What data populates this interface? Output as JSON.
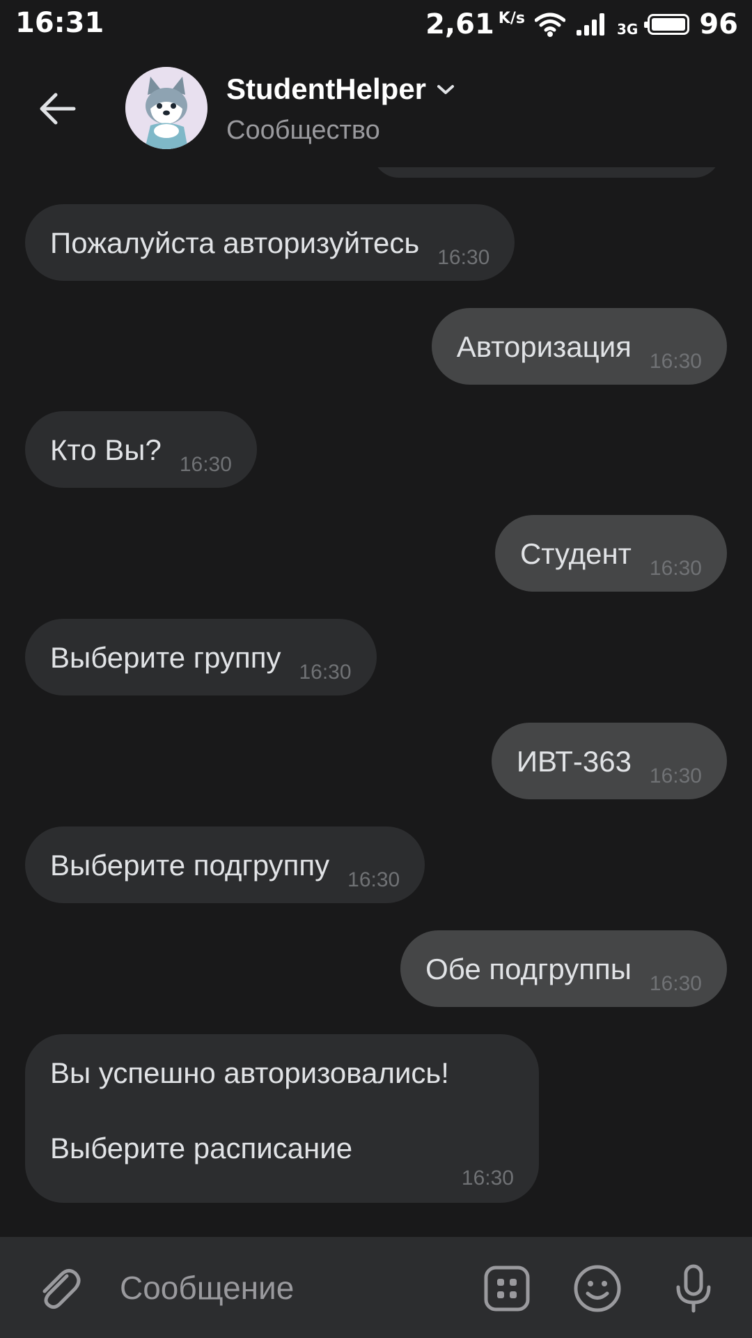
{
  "status_bar": {
    "time": "16:31",
    "speed": "2,61",
    "speed_unit": "K/s",
    "network": "3G",
    "battery": "96"
  },
  "header": {
    "title": "StudentHelper",
    "subtitle": "Сообщество"
  },
  "messages": [
    {
      "direction": "in",
      "text": "Пожалуйста авторизуйтесь",
      "time": "16:30"
    },
    {
      "direction": "out",
      "text": "Авторизация",
      "time": "16:30"
    },
    {
      "direction": "in",
      "text": "Кто Вы?",
      "time": "16:30"
    },
    {
      "direction": "out",
      "text": "Студент",
      "time": "16:30"
    },
    {
      "direction": "in",
      "text": "Выберите группу",
      "time": "16:30"
    },
    {
      "direction": "out",
      "text": "ИВТ-363",
      "time": "16:30"
    },
    {
      "direction": "in",
      "text": "Выберите подгруппу",
      "time": "16:30"
    },
    {
      "direction": "out",
      "text": "Обе подгруппы",
      "time": "16:30"
    },
    {
      "direction": "in",
      "text_line1": "Вы успешно авторизовались!",
      "text_line2": "Выберите расписание",
      "time": "16:30"
    }
  ],
  "input": {
    "placeholder": "Сообщение"
  },
  "icons": {
    "back": "back-arrow-icon",
    "attach": "paperclip-icon",
    "keyboard": "bot-keyboard-icon",
    "emoji": "smile-icon",
    "mic": "microphone-icon"
  },
  "colors": {
    "background": "#19191a",
    "incoming_bubble": "#2c2d2f",
    "outgoing_bubble": "#454647"
  }
}
